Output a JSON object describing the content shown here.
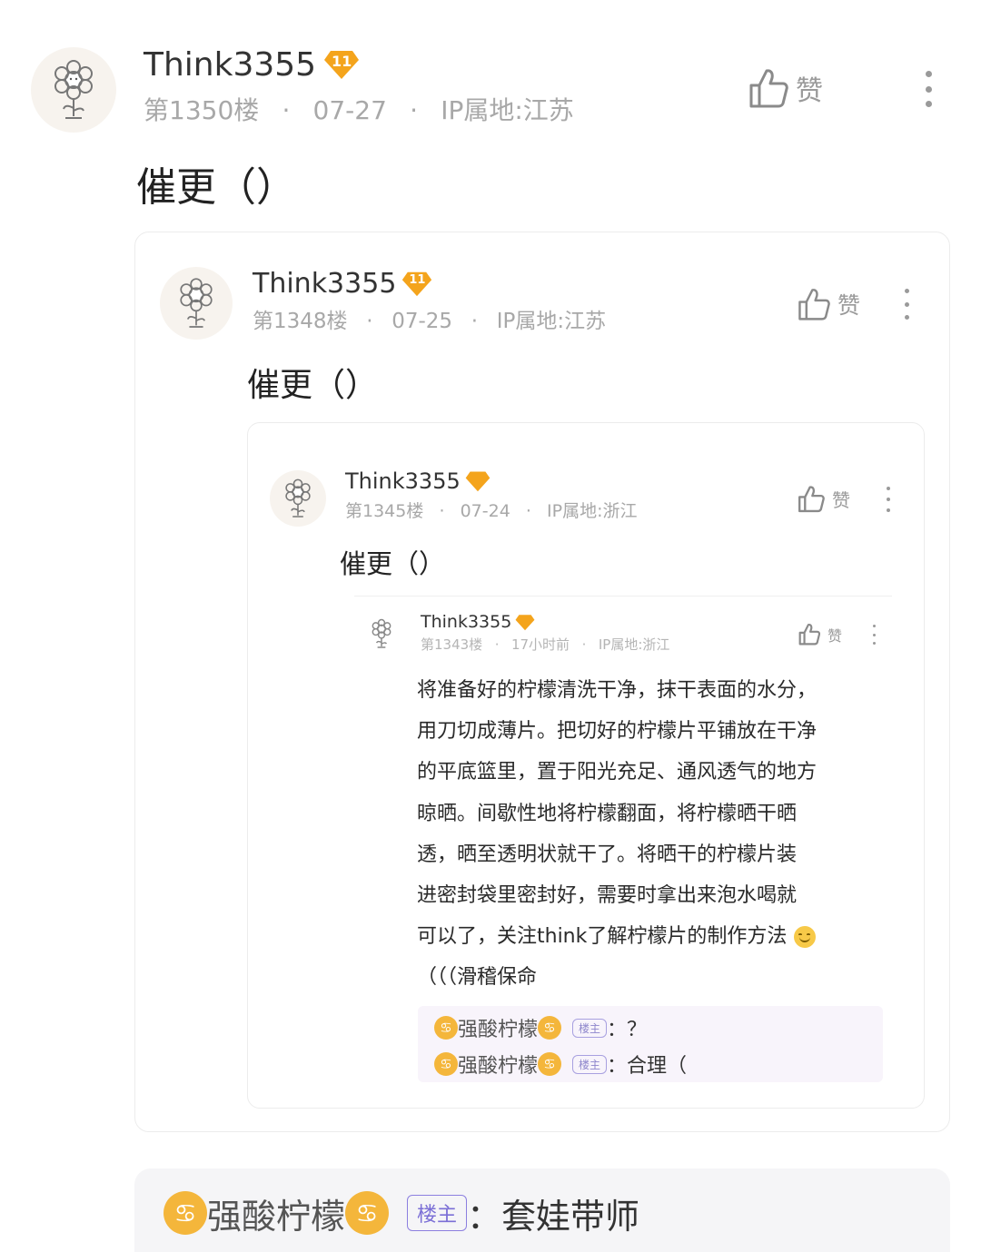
{
  "posts": [
    {
      "username": "Think3355",
      "level": "11",
      "floor": "第1350楼",
      "date": "07-27",
      "ip": "IP属地:江苏",
      "like_label": "赞",
      "content": "催更（）"
    },
    {
      "username": "Think3355",
      "level": "11",
      "floor": "第1348楼",
      "date": "07-25",
      "ip": "IP属地:江苏",
      "like_label": "赞",
      "content": "催更（）"
    },
    {
      "username": "Think3355",
      "level": "",
      "floor": "第1345楼",
      "date": "07-24",
      "ip": "IP属地:浙江",
      "like_label": "赞",
      "content": "催更（）"
    },
    {
      "username": "Think3355",
      "level": "",
      "floor": "第1343楼",
      "date": "17小时前",
      "ip": "IP属地:浙江",
      "like_label": "赞",
      "content_lines": [
        "将准备好的柠檬清洗干净，抹干表面的水分，",
        "用刀切成薄片。把切好的柠檬片平铺放在干净",
        "的平底篮里，置于阳光充足、通风透气的地方",
        "晾晒。间歇性地将柠檬翻面，将柠檬晒干晒",
        "透，晒至透明状就干了。将晒干的柠檬片装",
        "进密封袋里密封好，需要时拿出来泡水喝就",
        "可以了，关注think了解柠檬片的制作方法",
        "（（（滑稽保命"
      ],
      "replies": [
        {
          "name": "强酸柠檬",
          "tag": "楼主",
          "text": "：？"
        },
        {
          "name": "强酸柠檬",
          "tag": "楼主",
          "text": "：合理（"
        }
      ]
    }
  ],
  "bottom_reply": {
    "name": "强酸柠檬",
    "tag": "楼主",
    "text": "：套娃带师"
  },
  "colors": {
    "badge": "#f4a41c",
    "emoji": "#f4b63b",
    "tag": "#7b6fd6",
    "meta": "#a8a8a8"
  },
  "icons": {
    "like": "thumbs-up-icon",
    "more": "more-vertical-icon",
    "avatar": "flower-avatar-icon",
    "badge": "level-diamond-icon",
    "emoji": "cancer-zodiac-emoji"
  }
}
